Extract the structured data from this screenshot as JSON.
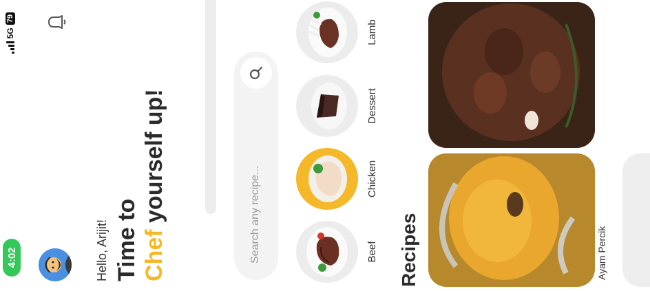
{
  "status": {
    "time": "4:02",
    "network": "5G",
    "battery": "79"
  },
  "header": {
    "greeting": "Hello, Arijit!",
    "title_line1": "Time to",
    "title_accent": "Chef",
    "title_rest": "yourself up!"
  },
  "search": {
    "placeholder": "Search any recipe..."
  },
  "categories": [
    {
      "label": "Beef"
    },
    {
      "label": "Chicken"
    },
    {
      "label": "Dessert"
    },
    {
      "label": "Lamb"
    }
  ],
  "recipes": {
    "title": "Recipes",
    "items": [
      {
        "name": "Ayam Percik"
      }
    ]
  },
  "colors": {
    "accent": "#f5b829",
    "time_pill": "#34c759",
    "avatar_bg": "#4a90e2"
  },
  "icons": [
    "bell-icon",
    "search-icon",
    "avatar"
  ]
}
